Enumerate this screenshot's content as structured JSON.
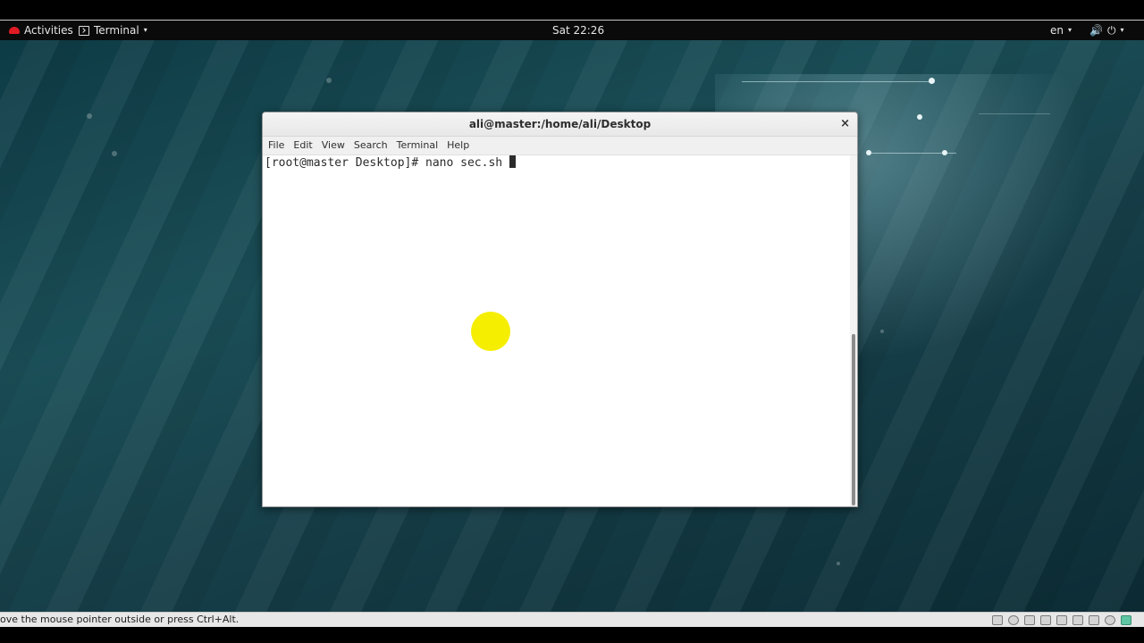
{
  "topbar": {
    "activities": "Activities",
    "app_menu": "Terminal",
    "clock": "Sat 22:26",
    "language": "en"
  },
  "terminal": {
    "title": "ali@master:/home/ali/Desktop",
    "close_glyph": "×",
    "menu": [
      "File",
      "Edit",
      "View",
      "Search",
      "Terminal",
      "Help"
    ],
    "lines": [
      "[root@master Desktop]# nano sec.sh "
    ]
  },
  "vbox_status": {
    "message": "ove the mouse pointer outside or press Ctrl+Alt."
  },
  "icons": {
    "volume": "🔊",
    "power": "⏻",
    "dropdown": "▾"
  }
}
